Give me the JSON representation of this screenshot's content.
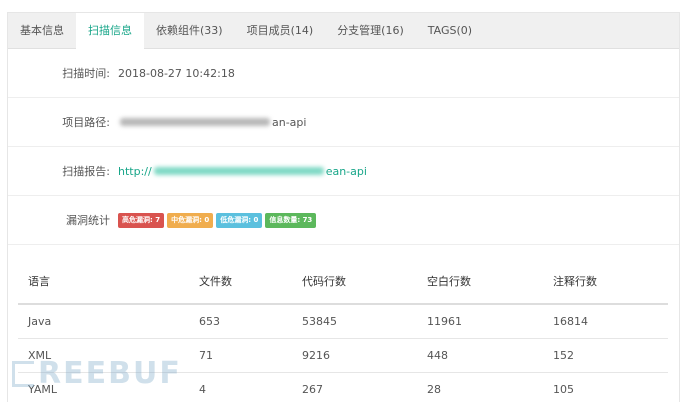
{
  "tabs": [
    {
      "label": "基本信息"
    },
    {
      "label": "扫描信息",
      "active": true
    },
    {
      "label": "依赖组件(33)"
    },
    {
      "label": "项目成员(14)"
    },
    {
      "label": "分支管理(16)"
    },
    {
      "label": "TAGS(0)"
    }
  ],
  "info": {
    "scan_time_label": "扫描时间:",
    "scan_time_value": "2018-08-27 10:42:18",
    "project_path_label": "项目路径:",
    "project_path_suffix": "an-api",
    "scan_report_label": "扫描报告:",
    "scan_report_prefix": "http://",
    "scan_report_suffix": "ean-api",
    "vuln_label": "漏洞统计"
  },
  "badges": [
    {
      "text": "高危漏洞: 7",
      "color": "#d9534f"
    },
    {
      "text": "中危漏洞: 0",
      "color": "#f0ad4e"
    },
    {
      "text": "低危漏洞: 0",
      "color": "#5bc0de"
    },
    {
      "text": "信息数量: 73",
      "color": "#5cb85c"
    }
  ],
  "table": {
    "headers": [
      "语言",
      "文件数",
      "代码行数",
      "空白行数",
      "注释行数"
    ],
    "rows": [
      [
        "Java",
        "653",
        "53845",
        "11961",
        "16814"
      ],
      [
        "XML",
        "71",
        "9216",
        "448",
        "152"
      ],
      [
        "YAML",
        "4",
        "267",
        "28",
        "105"
      ]
    ]
  },
  "watermark": {
    "text": "REEBUF"
  },
  "colors": {
    "accent": "#18a689",
    "tabbar": "#f0f0f0"
  }
}
